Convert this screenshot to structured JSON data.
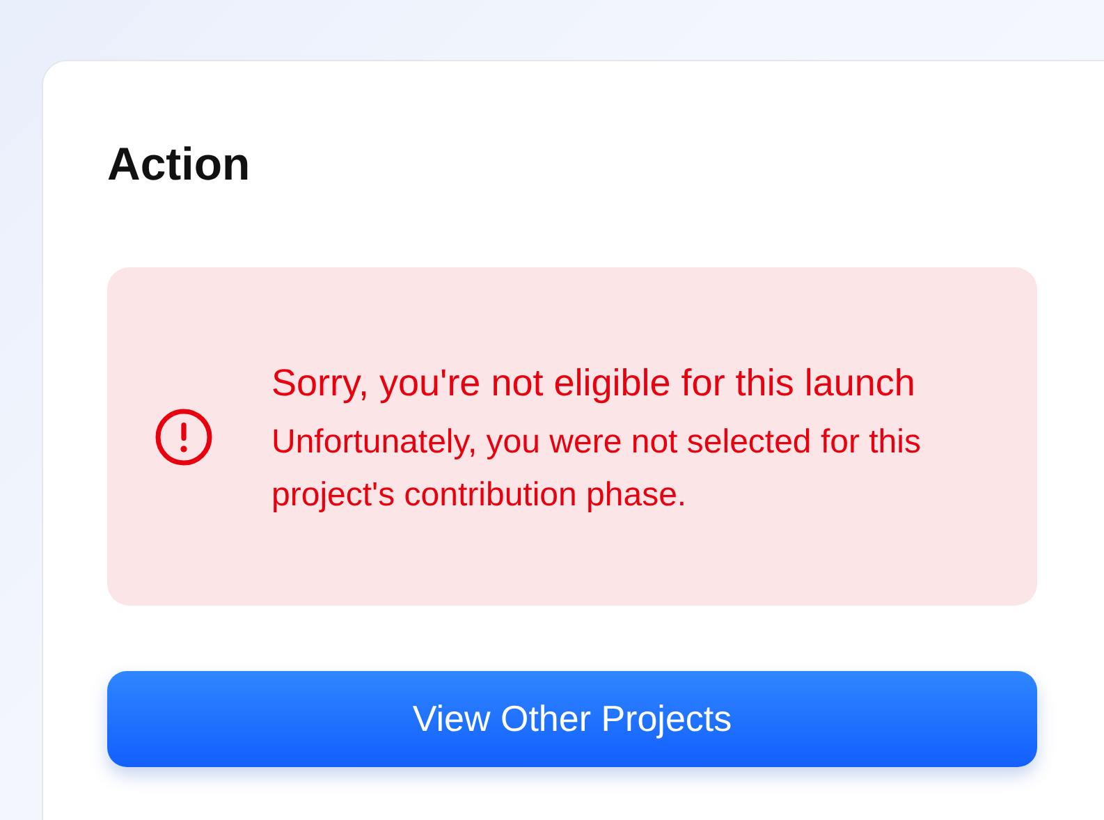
{
  "card": {
    "title": "Action"
  },
  "alert": {
    "kind": "error",
    "title": "Sorry, you're not eligible for this launch",
    "message": "Unfortunately, you were not selected for this project's contribution phase."
  },
  "button": {
    "label": "View Other Projects"
  }
}
